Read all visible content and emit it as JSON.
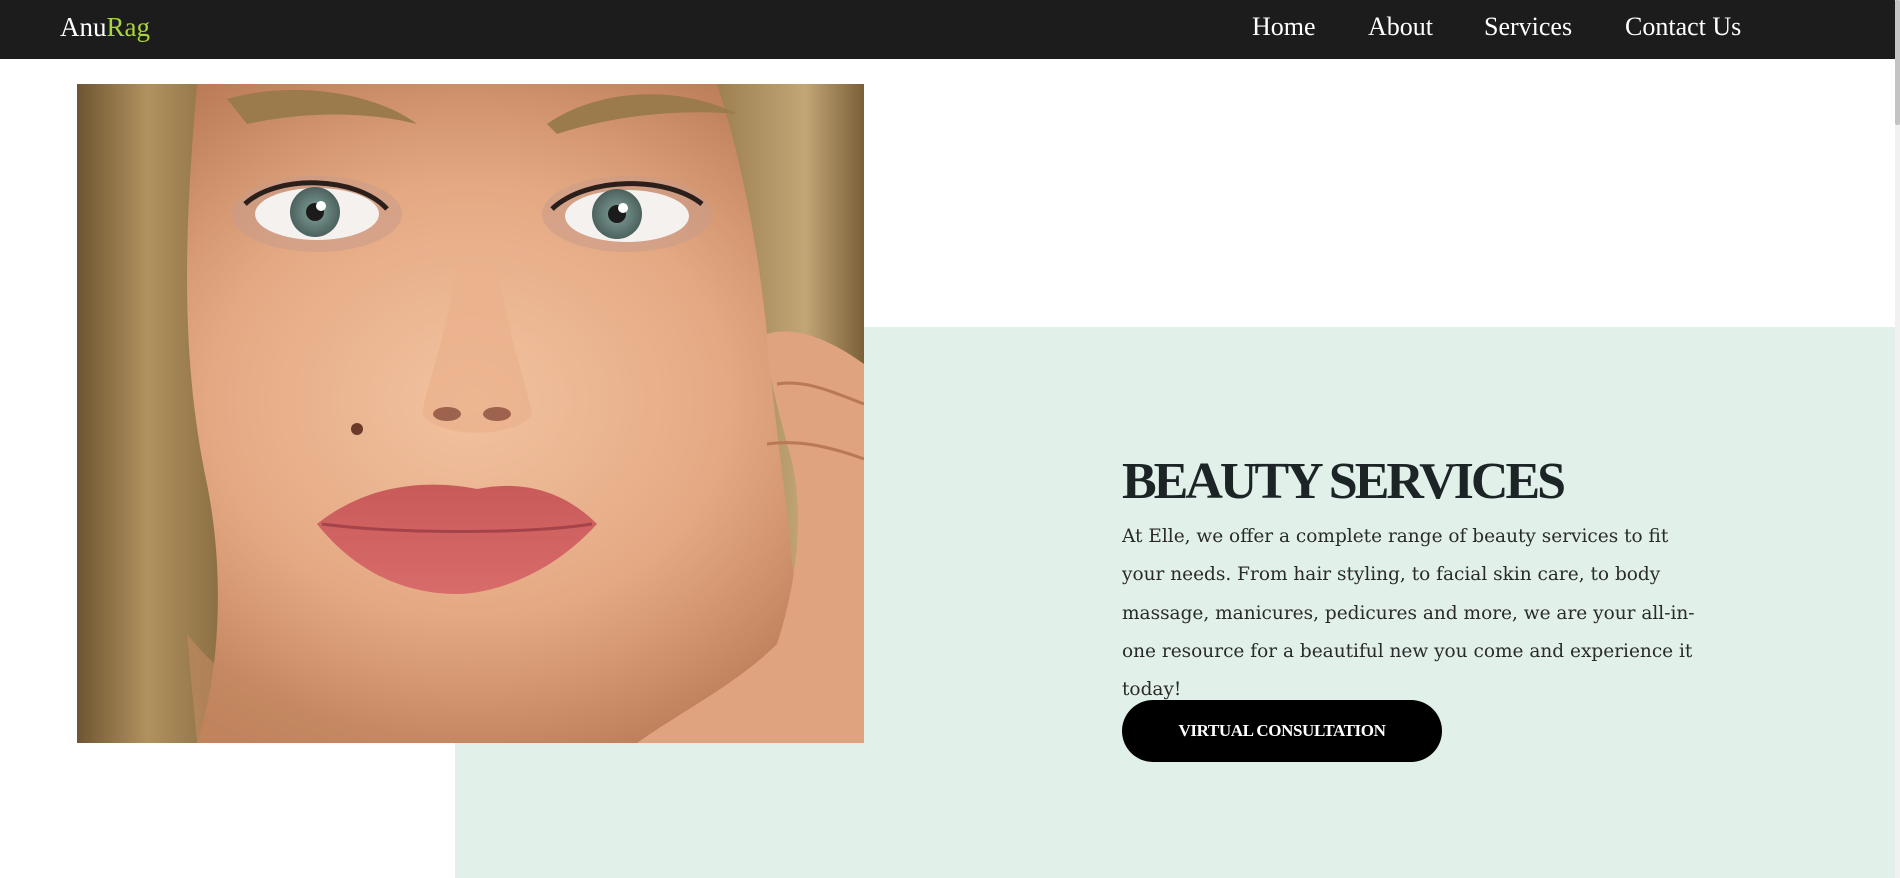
{
  "header": {
    "logo": {
      "part1": "Anu",
      "part2": "Rag"
    },
    "nav": [
      {
        "label": "Home"
      },
      {
        "label": "About"
      },
      {
        "label": "Services"
      },
      {
        "label": "Contact Us"
      }
    ]
  },
  "hero": {
    "image_subject": "close-up portrait of a blonde woman with freckles",
    "title": "BEAUTY SERVICES",
    "description": "At Elle, we offer a complete range of beauty services to fit your needs. From hair styling, to facial skin care, to body massage, manicures, pedicures and more, we are your all-in-one resource for a beautiful new you come and experience it today!",
    "cta_label": "VIRTUAL CONSULTATION"
  },
  "colors": {
    "navbar_bg": "#1c1c1c",
    "logo_accent": "#a8d43c",
    "mint_panel": "#e1f0e9",
    "heading_text": "#1d2426",
    "button_bg": "#000000"
  }
}
